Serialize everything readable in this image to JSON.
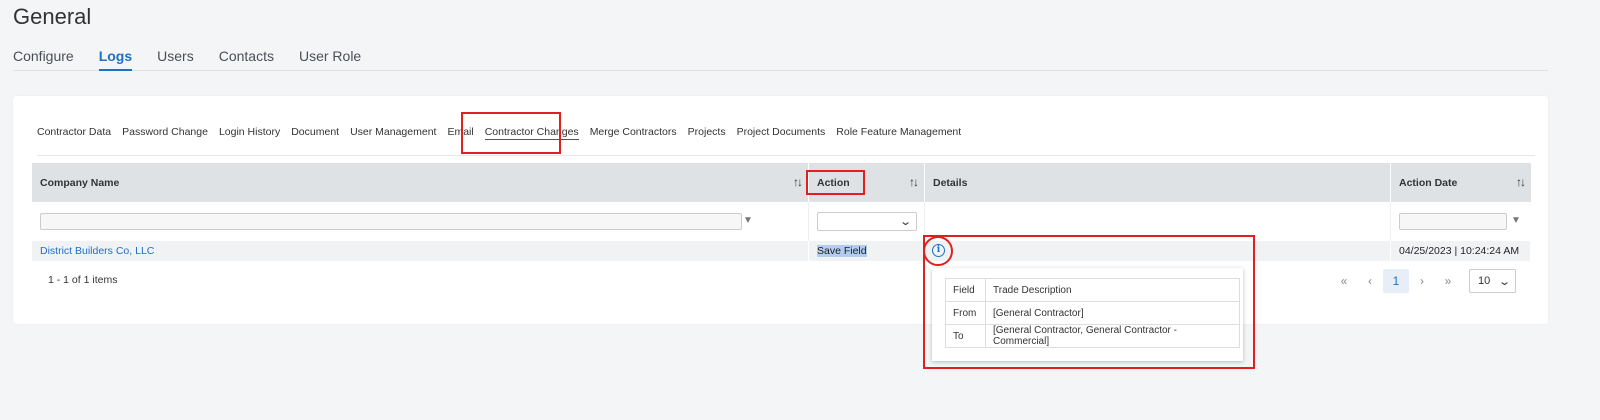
{
  "page": {
    "title": "General"
  },
  "main_tabs": [
    {
      "label": "Configure",
      "active": false
    },
    {
      "label": "Logs",
      "active": true
    },
    {
      "label": "Users",
      "active": false
    },
    {
      "label": "Contacts",
      "active": false
    },
    {
      "label": "User Role",
      "active": false
    }
  ],
  "sub_tabs": [
    {
      "label": "Contractor Data"
    },
    {
      "label": "Password Change"
    },
    {
      "label": "Login History"
    },
    {
      "label": "Document"
    },
    {
      "label": "User Management"
    },
    {
      "label": "Email"
    },
    {
      "label": "Contractor Changes",
      "active": true
    },
    {
      "label": "Merge Contractors"
    },
    {
      "label": "Projects"
    },
    {
      "label": "Project Documents"
    },
    {
      "label": "Role Feature Management"
    }
  ],
  "grid": {
    "columns": [
      "Company Name",
      "Action",
      "Details",
      "Action Date"
    ],
    "rows": [
      {
        "company": "District Builders Co, LLC",
        "action": "Save Field",
        "details_icon": "info-icon",
        "date": "04/25/2023 | 10:24:24 AM"
      }
    ],
    "footer_count": "1 - 1 of 1 items"
  },
  "pager": {
    "first": "«",
    "prev": "‹",
    "current": "1",
    "next": "›",
    "last": "»",
    "page_size": "10"
  },
  "details_popup": {
    "rows": [
      {
        "key": "Field",
        "value": "Trade Description"
      },
      {
        "key": "From",
        "value": "[General Contractor]"
      },
      {
        "key": "To",
        "value": "[General Contractor, General Contractor - Commercial]"
      }
    ]
  },
  "colors": {
    "accent": "#1f6fc5",
    "annotation": "#e02020",
    "header_bg": "#dfe2e5"
  }
}
